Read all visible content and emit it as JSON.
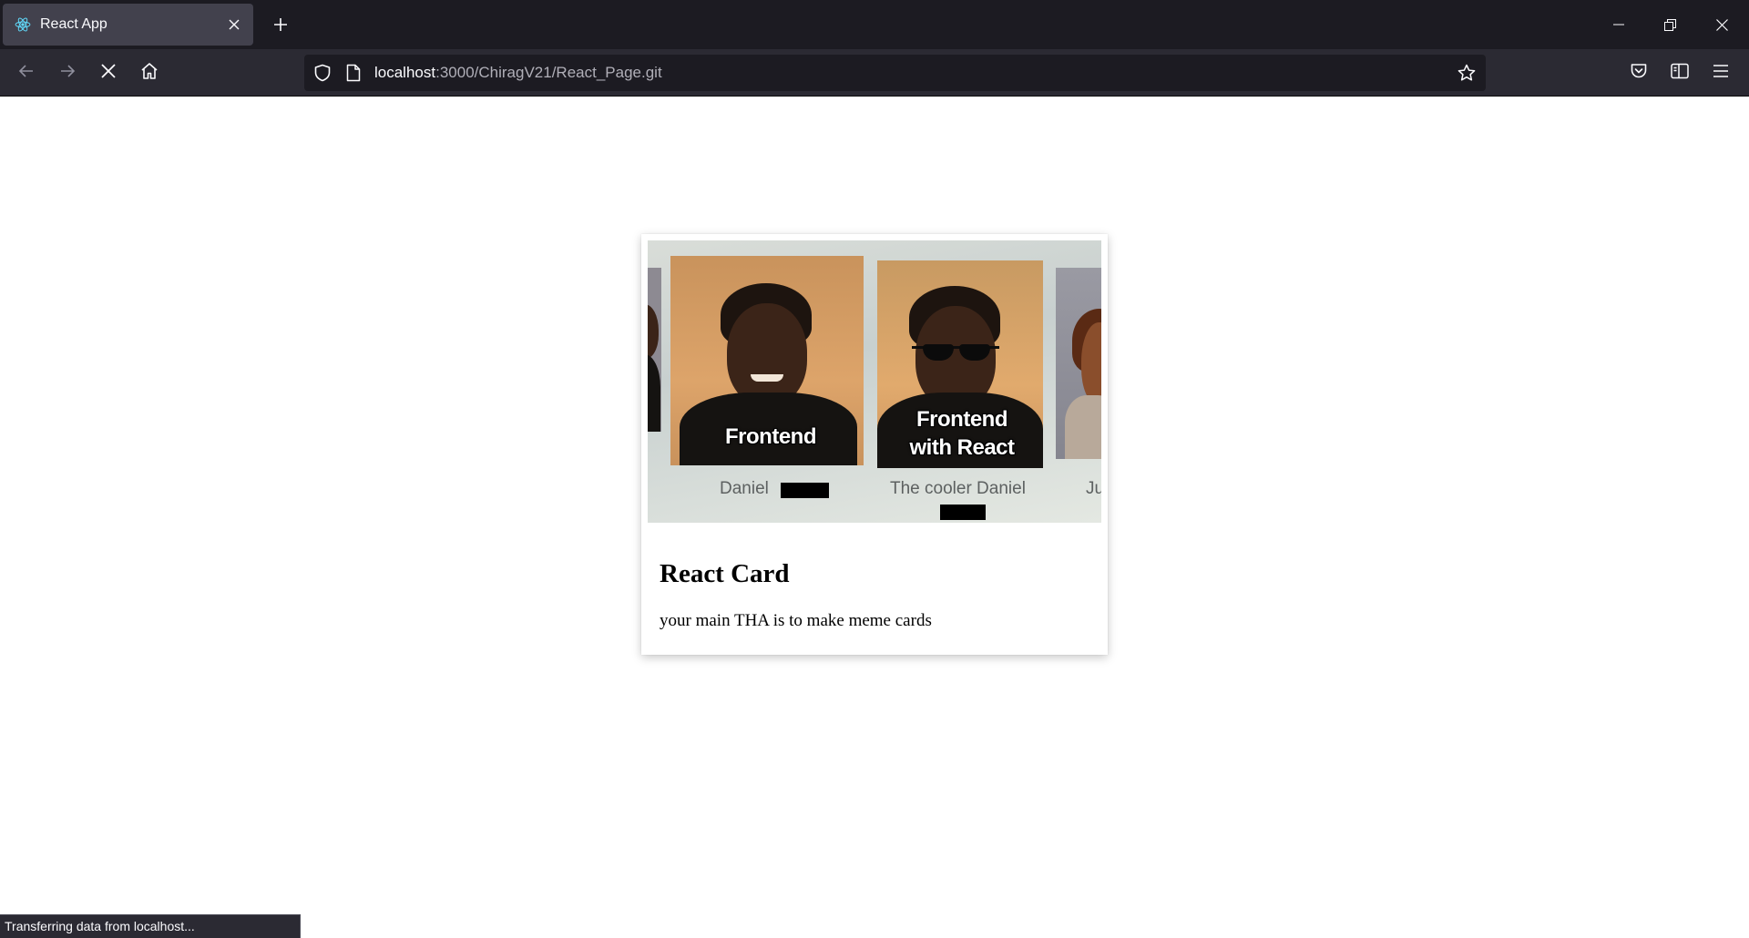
{
  "browser": {
    "tab": {
      "title": "React App",
      "favicon": "react-logo-icon"
    },
    "url": {
      "host": "localhost",
      "rest": ":3000/ChiragV21/React_Page.git"
    },
    "status": "Transferring data from localhost..."
  },
  "card": {
    "meme": {
      "left_caption": "Frontend",
      "right_caption_line1": "Frontend",
      "right_caption_line2": "with React",
      "left_name": "Daniel",
      "right_name": "The cooler Daniel",
      "edge_name": "Ju"
    },
    "title": "React Card",
    "text": "your main THA is to make meme cards"
  },
  "colors": {
    "chrome_dark": "#1c1b22",
    "chrome_toolbar": "#2b2a33",
    "tab_active": "#42414d"
  }
}
